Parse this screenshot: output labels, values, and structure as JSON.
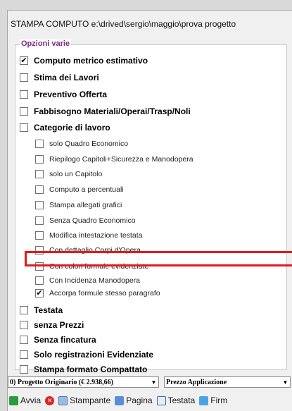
{
  "window": {
    "title": "STAMPA  COMPUTO  e:\\drived\\sergio\\maggio\\prova  progetto"
  },
  "options_group": {
    "title": "Opzioni varie",
    "items": [
      {
        "label": "Computo metrico estimativo",
        "checked": true,
        "style": "bold"
      },
      {
        "label": "Stima dei Lavori",
        "checked": false,
        "style": "bold"
      },
      {
        "label": "Preventivo Offerta",
        "checked": false,
        "style": "bold"
      },
      {
        "label": "Fabbisogno Materiali/Operai/Trasp/Noli",
        "checked": false,
        "style": "bold"
      },
      {
        "label": "Categorie di lavoro",
        "checked": false,
        "style": "bold"
      }
    ],
    "sub_items": [
      {
        "label": "solo Quadro Economico",
        "checked": false
      },
      {
        "label": "Riepilogo Capitoli+Sicurezza e Manodopera",
        "checked": false
      },
      {
        "label": "solo un Capitolo",
        "checked": false
      },
      {
        "label": "Computo a percentuali",
        "checked": false
      },
      {
        "label": "Stampa allegati grafici",
        "checked": false
      },
      {
        "label": "Senza Quadro Economico",
        "checked": false
      },
      {
        "label": "Modifica intestazione testata",
        "checked": false
      },
      {
        "label": "Con dettaglio Corpi d'Opera",
        "checked": false
      },
      {
        "label": "Con colori formule evidenziate",
        "checked": false
      },
      {
        "label": "Con Incidenza Manodopera",
        "checked": false
      },
      {
        "label": "Accorpa formule stesso paragrafo",
        "checked": true
      }
    ],
    "bottom_items": [
      {
        "label": "Testata",
        "checked": false
      },
      {
        "label": "senza Prezzi",
        "checked": false
      },
      {
        "label": "Senza fincatura",
        "checked": false
      },
      {
        "label": "Solo registrazioni Evidenziate",
        "checked": false
      },
      {
        "label": "Stampa formato Compattato",
        "checked": false
      }
    ]
  },
  "selects": {
    "project": "0) Progetto Originario (€ 2.938,66)",
    "price": "Prezzo Applicazione"
  },
  "toolbar": {
    "start": "Avvia",
    "printer": "Stampante",
    "page": "Pagina",
    "header": "Testata",
    "sign": "Firm"
  },
  "check_glyph": "✔",
  "highlight_color": "#e21b1b"
}
